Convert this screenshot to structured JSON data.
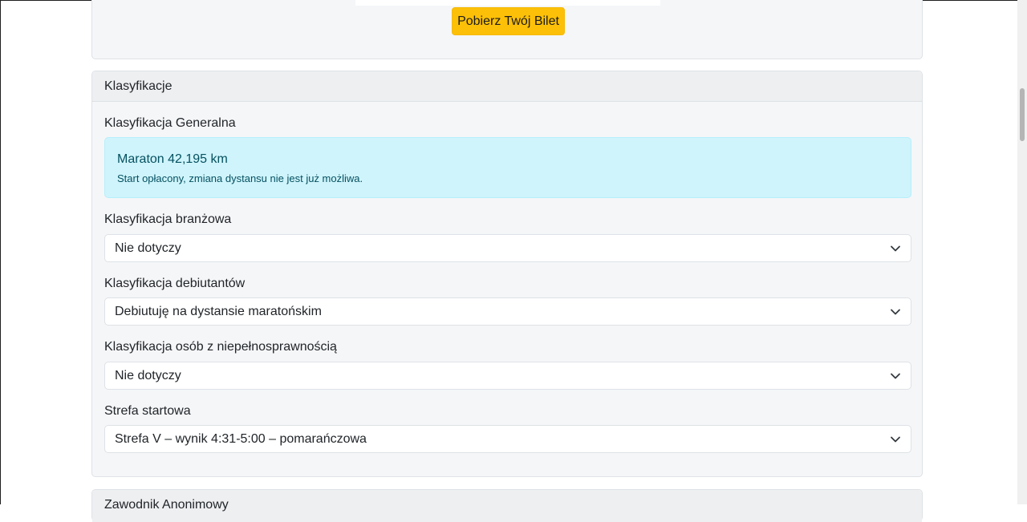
{
  "ticket": {
    "button_label": "Pobierz Twój Bilet"
  },
  "classifications": {
    "header": "Klasyfikacje",
    "general": {
      "label": "Klasyfikacja Generalna",
      "alert_title": "Maraton 42,195 km",
      "alert_text": "Start opłacony, zmiana dystansu nie jest już możliwa."
    },
    "industry": {
      "label": "Klasyfikacja branżowa",
      "selected": "Nie dotyczy"
    },
    "debutants": {
      "label": "Klasyfikacja debiutantów",
      "selected": "Debiutuję na dystansie maratońskim"
    },
    "disabled": {
      "label": "Klasyfikacja osób z niepełnosprawnością",
      "selected": "Nie dotyczy"
    },
    "start_zone": {
      "label": "Strefa startowa",
      "selected": "Strefa V – wynik 4:31-5:00 – pomarańczowa"
    }
  },
  "anonymous": {
    "header": "Zawodnik Anonimowy"
  },
  "colors": {
    "ticket_button": "#fcc008",
    "alert_bg": "#cff4fc",
    "card_bg": "#f5f6f8"
  },
  "icons": {
    "select_chevron": "chevron-down-icon"
  }
}
